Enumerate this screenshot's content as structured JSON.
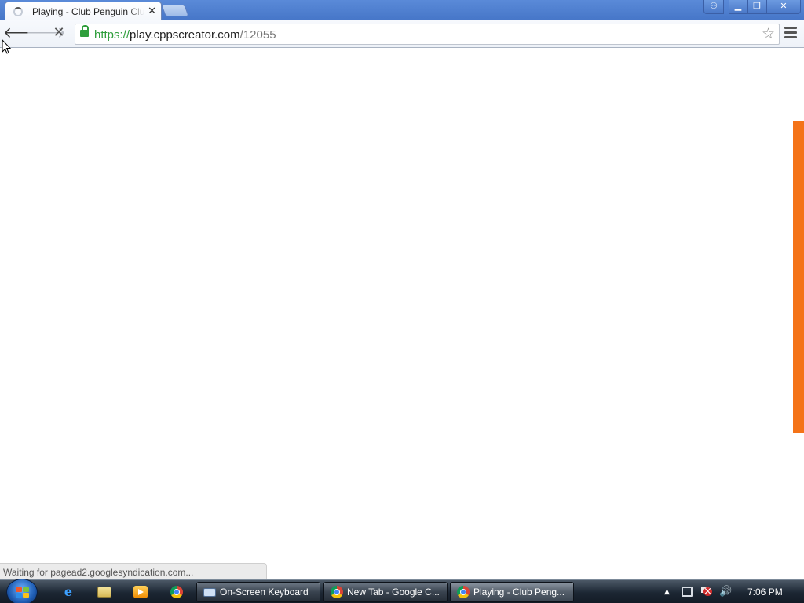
{
  "browser": {
    "tab": {
      "title": "Playing - Club Penguin Club",
      "close_glyph": "✕"
    },
    "window_controls": {
      "user_glyph": "⚇",
      "minimize_glyph": "▁",
      "restore_glyph": "❐",
      "close_glyph": "✕"
    },
    "toolbar": {
      "back_glyph": "🡐",
      "forward_glyph": "🡒",
      "stop_glyph": "✕",
      "url": {
        "scheme": "https://",
        "host": "play.cppscreator.com",
        "path": "/12055"
      },
      "bookmark_glyph": "☆"
    },
    "status_text": "Waiting for pagead2.googlesyndication.com..."
  },
  "taskbar": {
    "ie_glyph": "e",
    "tasks": [
      {
        "label": "On-Screen Keyboard"
      },
      {
        "label": "New Tab - Google C..."
      },
      {
        "label": "Playing - Club Peng..."
      }
    ],
    "tray": {
      "arrow_glyph": "▲",
      "volume_glyph": "🔊",
      "clock": "7:06 PM"
    }
  },
  "colors": {
    "accent_orange": "#f47318",
    "secure_green": "#2f9e3c",
    "titlebar_blue": "#4676c8"
  }
}
